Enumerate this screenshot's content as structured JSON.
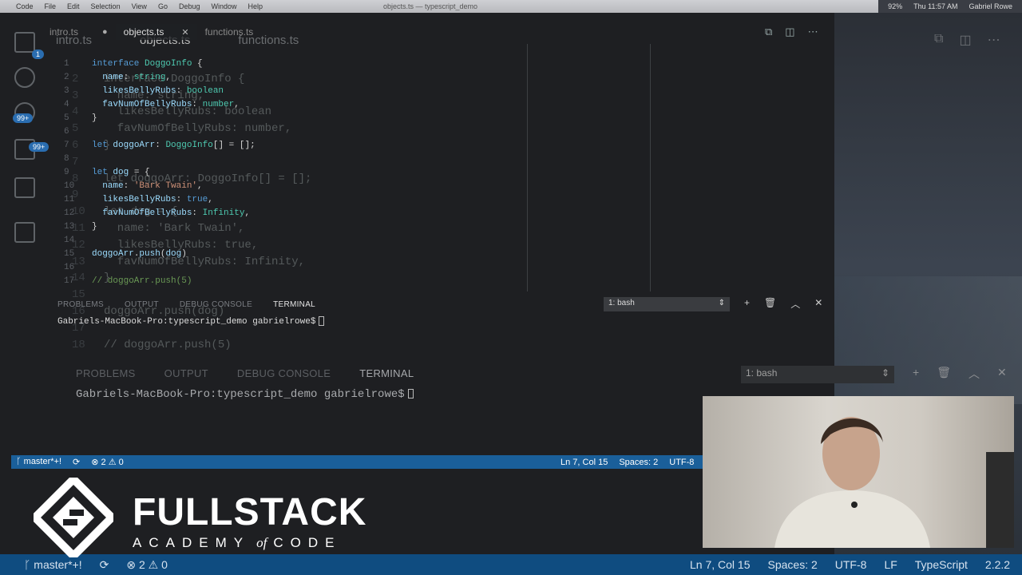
{
  "menubar": {
    "left": [
      "Code",
      "File",
      "Edit",
      "Selection",
      "View",
      "Go",
      "Debug",
      "Window",
      "Help"
    ],
    "window_title": "objects.ts — typescript_demo",
    "clock": "Thu 11:57 AM",
    "user": "Gabriel Rowe",
    "battery": "92%"
  },
  "tabs": [
    {
      "label": "intro.ts",
      "state": "modified"
    },
    {
      "label": "objects.ts",
      "state": "active"
    },
    {
      "label": "functions.ts",
      "state": "normal"
    }
  ],
  "activity_badges": [
    "1",
    "99+"
  ],
  "code_lines": [
    {
      "n": "1",
      "text": "interface DoggoInfo {"
    },
    {
      "n": "2",
      "text": "  name: string,"
    },
    {
      "n": "3",
      "text": "  likesBellyRubs: boolean"
    },
    {
      "n": "4",
      "text": "  favNumOfBellyRubs: number,"
    },
    {
      "n": "5",
      "text": "}"
    },
    {
      "n": "6",
      "text": ""
    },
    {
      "n": "7",
      "text": "let doggoArr: DoggoInfo[] = [];"
    },
    {
      "n": "8",
      "text": ""
    },
    {
      "n": "9",
      "text": "let dog = {"
    },
    {
      "n": "10",
      "text": "  name: 'Bark Twain',"
    },
    {
      "n": "11",
      "text": "  likesBellyRubs: true,"
    },
    {
      "n": "12",
      "text": "  favNumOfBellyRubs: Infinity,"
    },
    {
      "n": "13",
      "text": "}"
    },
    {
      "n": "14",
      "text": ""
    },
    {
      "n": "15",
      "text": "doggoArr.push(dog)"
    },
    {
      "n": "16",
      "text": ""
    },
    {
      "n": "17",
      "text": "// doggoArr.push(5)"
    }
  ],
  "panel": {
    "tabs": [
      "PROBLEMS",
      "OUTPUT",
      "DEBUG CONSOLE",
      "TERMINAL"
    ],
    "active_tab": "TERMINAL",
    "terminal_select": "1: bash",
    "prompt": "Gabriels-MacBook-Pro:typescript_demo gabrielrowe$"
  },
  "status": {
    "branch": "master*+!",
    "errors": "2",
    "warnings": "0",
    "position": "Ln 7, Col 15",
    "spaces": "Spaces: 2",
    "encoding": "UTF-8",
    "eol": "LF",
    "language": "TypeScript",
    "version": "2.2.2"
  },
  "branding": {
    "name": "FULLSTACK",
    "sub_left": "ACADEMY",
    "sub_of": "of",
    "sub_right": "CODE"
  },
  "colors": {
    "status_bar": "#1a5f9a",
    "background": "#1e1f22",
    "keyword": "#569cd6",
    "type": "#4ec9b0",
    "string": "#ce9178"
  }
}
